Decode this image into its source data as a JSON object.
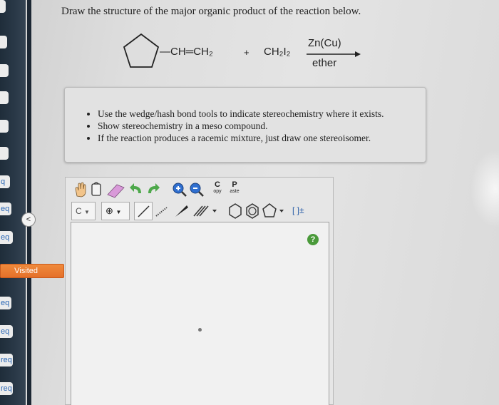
{
  "sidebar": {
    "tabs": [
      "",
      "",
      "",
      "",
      "",
      "",
      "q",
      "eq",
      "eq",
      "eq",
      "eq",
      "req",
      "req"
    ],
    "visited_label": "Visited"
  },
  "question": {
    "prompt": "Draw the structure of the major organic product of the reaction below."
  },
  "reaction": {
    "substituent": "—CH═CH₂",
    "plus": "+",
    "reagent": "CH₂I₂",
    "above_arrow": "Zn(Cu)",
    "below_arrow": "ether"
  },
  "instructions": [
    "Use the wedge/hash bond tools to indicate stereochemistry where it exists.",
    "Show stereochemistry in a meso compound.",
    "If the reaction produces a racemic mixture, just draw one stereoisomer."
  ],
  "toolbar": {
    "copy_top": "C",
    "copy_bottom": "opy",
    "paste_top": "P",
    "paste_bottom": "aste",
    "element": "C",
    "bracket": "[ ]±"
  },
  "help": {
    "label": "?"
  },
  "colors": {
    "visited": "#e97a32",
    "help": "#4a9a3a",
    "nav": "#2a3948"
  }
}
